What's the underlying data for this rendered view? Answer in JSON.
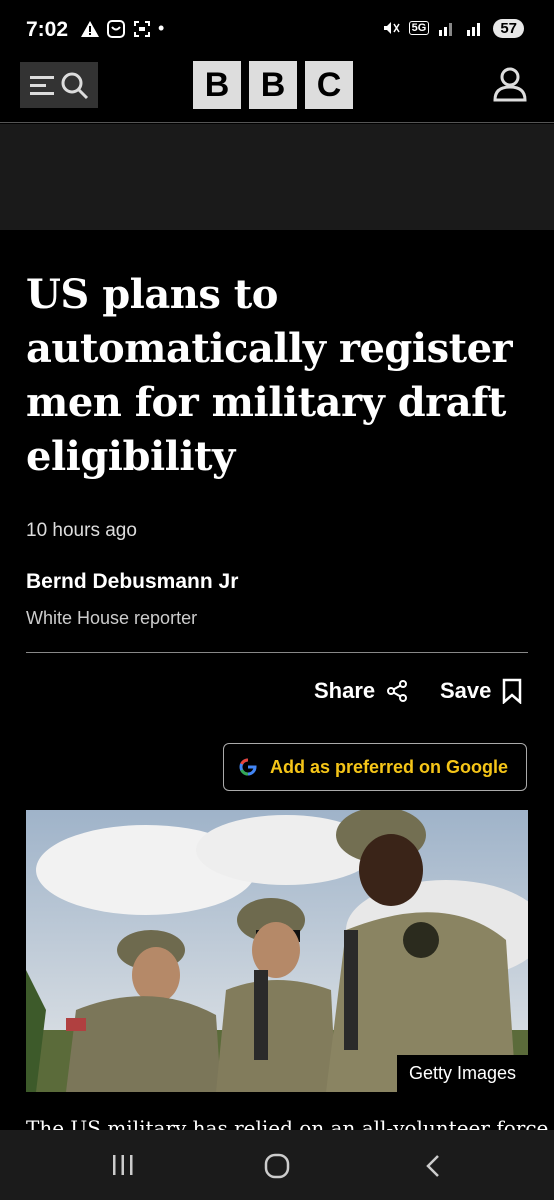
{
  "status_bar": {
    "time": "7:02",
    "battery": "57",
    "network": "5G"
  },
  "header": {
    "logo_letters": [
      "B",
      "B",
      "C"
    ]
  },
  "article": {
    "headline": "US plans to automatically register men for military draft eligibility",
    "time_ago": "10 hours ago",
    "author": "Bernd Debusmann Jr",
    "author_role": "White House reporter",
    "share_label": "Share",
    "save_label": "Save",
    "google_label": "Add as preferred on Google",
    "image_credit": "Getty Images",
    "body_preview": "The US military has relied on an all-volunteer force"
  },
  "colors": {
    "background": "#000000",
    "google_text": "#f5c518",
    "logo_block": "#dddddd"
  },
  "icons": {
    "menu": "menu-icon",
    "search": "search-icon",
    "account": "account-icon",
    "share": "share-icon",
    "bookmark": "bookmark-icon",
    "google": "google-icon"
  }
}
